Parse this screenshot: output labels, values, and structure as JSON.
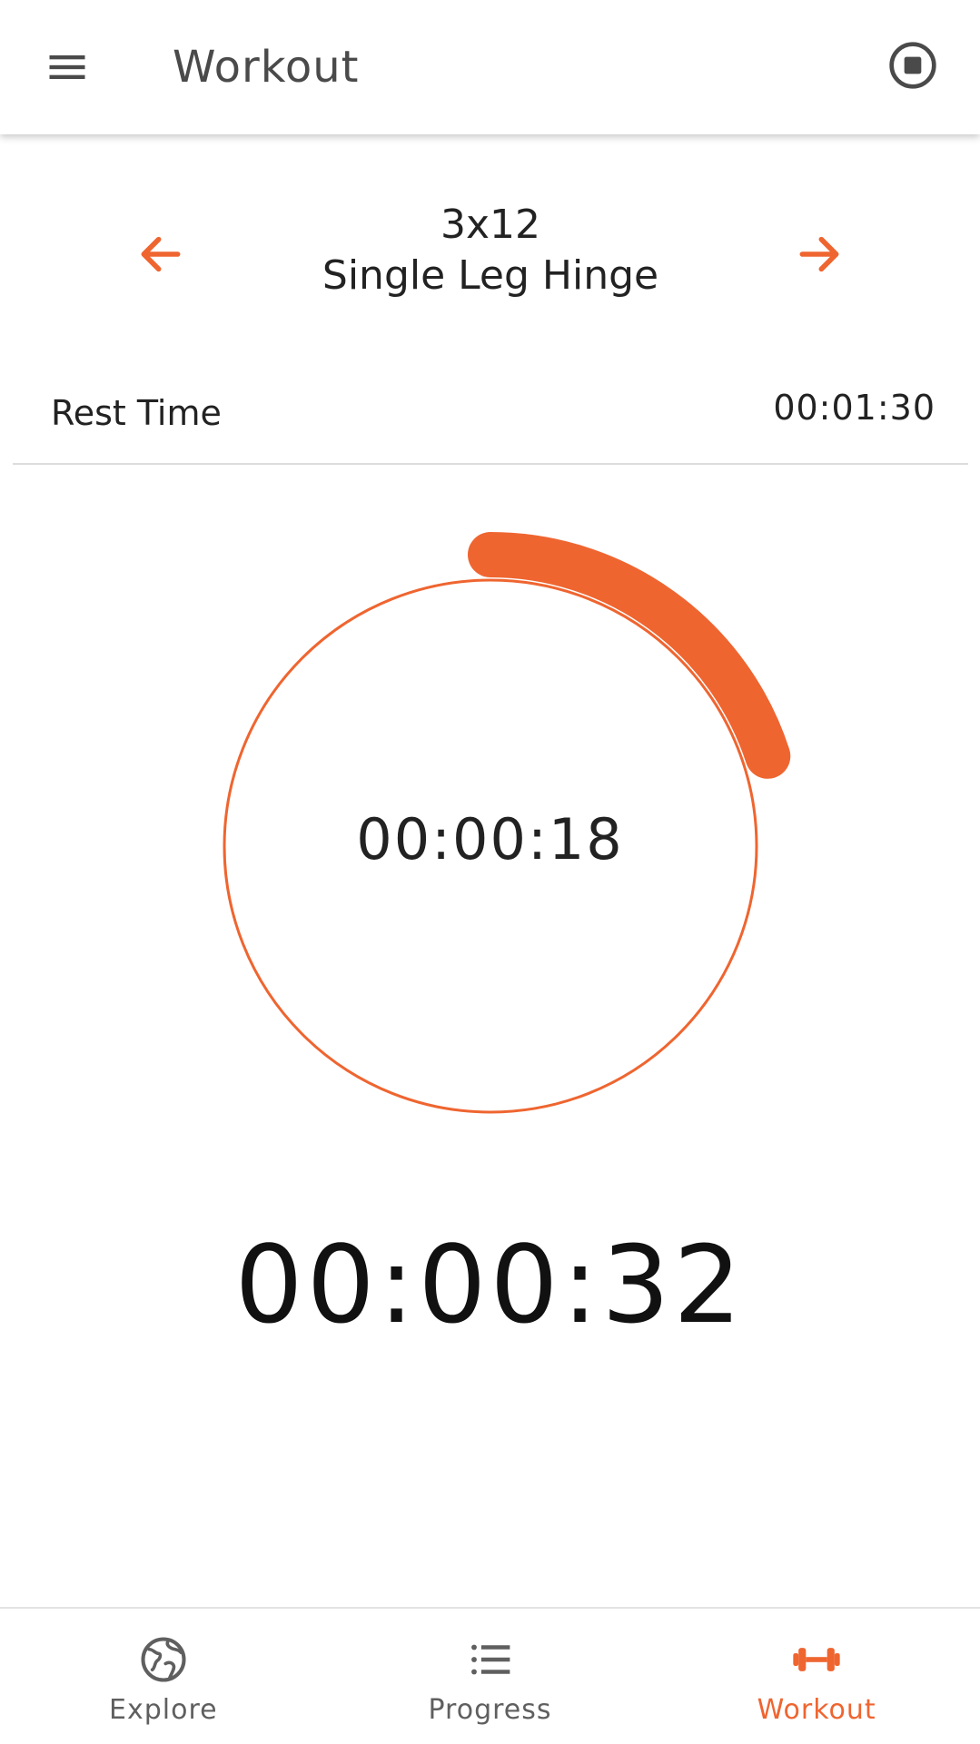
{
  "app_bar": {
    "title": "Workout",
    "menu_icon": "menu-icon",
    "stop_icon": "stop-circle-icon"
  },
  "exercise": {
    "sets": "3x12",
    "name": "Single Leg Hinge",
    "prev_icon": "arrow-left-icon",
    "next_icon": "arrow-right-icon"
  },
  "rest": {
    "label": "Rest Time",
    "value": "00:01:30"
  },
  "rest_timer": {
    "elapsed": "00:00:18",
    "progress_fraction": 0.2
  },
  "total_time": "00:00:32",
  "bottom_nav": {
    "tabs": [
      {
        "label": "Explore",
        "icon": "globe-icon",
        "active": false
      },
      {
        "label": "Progress",
        "icon": "list-icon",
        "active": false
      },
      {
        "label": "Workout",
        "icon": "dumbbell-icon",
        "active": true
      }
    ]
  },
  "colors": {
    "accent": "#ef6530",
    "text": "#222222",
    "icon_gray": "#5f5f5f"
  }
}
